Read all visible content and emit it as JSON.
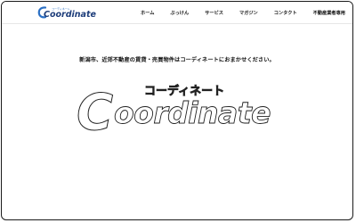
{
  "header": {
    "logo": {
      "small_kana": "コーディネート",
      "wordmark": "Coordinate"
    },
    "nav": [
      {
        "label": "ホーム"
      },
      {
        "label": "ぶっけん"
      },
      {
        "label": "サービス"
      },
      {
        "label": "マガジン"
      },
      {
        "label": "コンタクト"
      },
      {
        "label": "不動産業者専用"
      }
    ]
  },
  "main": {
    "tagline": "新潟市、近郊不動産の賃貸・売買物件はコーディネートにおまかせください。",
    "brand_logo": {
      "kana": "コーディネート",
      "wordmark_initial": "C",
      "wordmark_rest": "oordinate"
    }
  },
  "colors": {
    "logo_blue": "#2a6fc4",
    "outline": "#222222"
  }
}
